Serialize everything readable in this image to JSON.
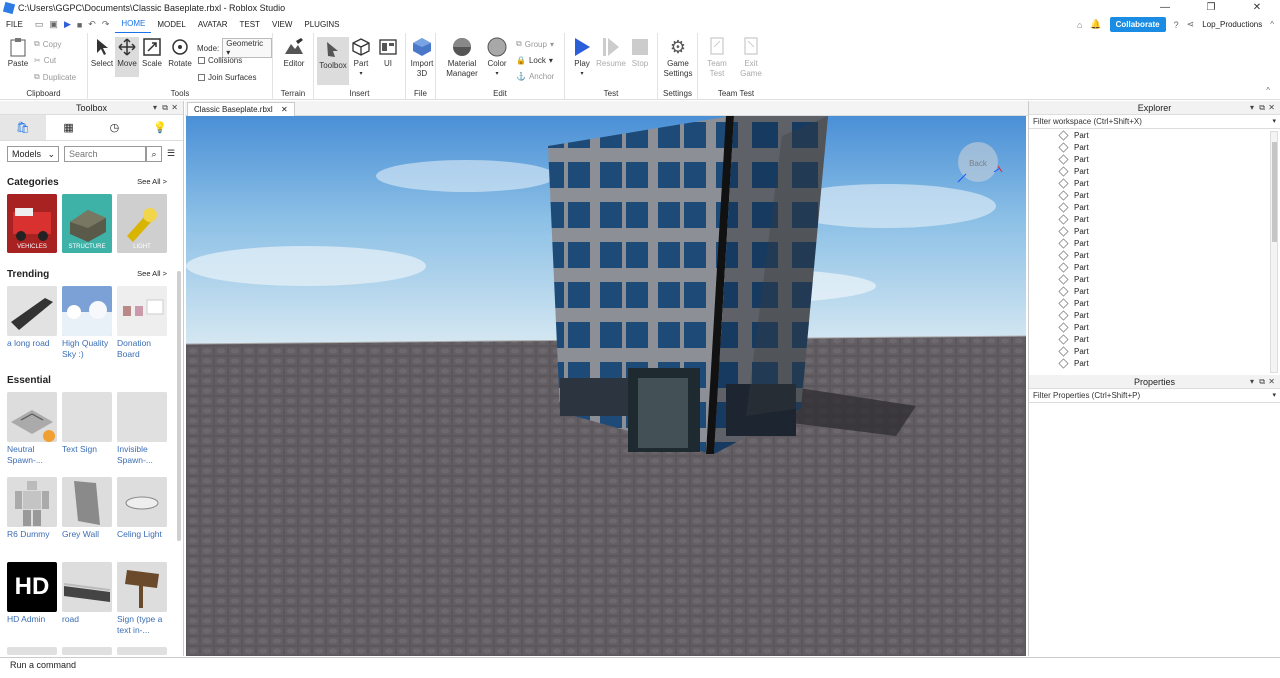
{
  "window": {
    "title": "C:\\Users\\GGPC\\Documents\\Classic Baseplate.rbxl - Roblox Studio"
  },
  "menu": {
    "tabs": [
      "FILE",
      "HOME",
      "MODEL",
      "AVATAR",
      "TEST",
      "VIEW",
      "PLUGINS"
    ],
    "active": "HOME"
  },
  "topright": {
    "collaborate": "Collaborate",
    "user": "Lop_Productions"
  },
  "ribbon": {
    "clipboard": {
      "paste": "Paste",
      "copy": "Copy",
      "cut": "Cut",
      "duplicate": "Duplicate",
      "label": "Clipboard"
    },
    "tools": {
      "select": "Select",
      "move": "Move",
      "scale": "Scale",
      "rotate": "Rotate",
      "mode_label": "Mode:",
      "mode_value": "Geometric",
      "collisions": "Collisions",
      "join_surfaces": "Join Surfaces",
      "label": "Tools"
    },
    "terrain": {
      "editor": "Editor",
      "label": "Terrain"
    },
    "insert": {
      "toolbox": "Toolbox",
      "part": "Part",
      "ui": "UI",
      "label": "Insert"
    },
    "file": {
      "import_line1": "Import",
      "import_line2": "3D",
      "label": "File"
    },
    "edit": {
      "material_line1": "Material",
      "material_line2": "Manager",
      "color": "Color",
      "group": "Group",
      "lock": "Lock",
      "anchor": "Anchor",
      "label": "Edit"
    },
    "test": {
      "play": "Play",
      "resume": "Resume",
      "stop": "Stop",
      "label": "Test"
    },
    "settings": {
      "game_line1": "Game",
      "game_line2": "Settings",
      "label": "Settings"
    },
    "teamtest": {
      "team_line1": "Team",
      "team_line2": "Test",
      "exit_line1": "Exit",
      "exit_line2": "Game",
      "label": "Team Test"
    }
  },
  "toolbox": {
    "title": "Toolbox",
    "category_select": "Models",
    "search_placeholder": "Search",
    "categories_title": "Categories",
    "see_all": "See All >",
    "categories": [
      "VEHICLES",
      "STRUCTURE",
      "LIGHT"
    ],
    "trending_title": "Trending",
    "trending": [
      {
        "name_line1": "a long road",
        "name_line2": ""
      },
      {
        "name_line1": "High Quality",
        "name_line2": "Sky :)"
      },
      {
        "name_line1": "Donation",
        "name_line2": "Board"
      }
    ],
    "essential_title": "Essential",
    "essential": [
      {
        "name_line1": "Neutral",
        "name_line2": "Spawn-..."
      },
      {
        "name_line1": "Text Sign",
        "name_line2": ""
      },
      {
        "name_line1": "Invisible",
        "name_line2": "Spawn-..."
      },
      {
        "name_line1": "R6 Dummy",
        "name_line2": ""
      },
      {
        "name_line1": "Grey Wall",
        "name_line2": ""
      },
      {
        "name_line1": "Celing Light",
        "name_line2": ""
      },
      {
        "name_line1": "HD Admin",
        "name_line2": ""
      },
      {
        "name_line1": "road",
        "name_line2": ""
      },
      {
        "name_line1": "Sign (type a",
        "name_line2": "text in-..."
      }
    ],
    "hd_text": "HD"
  },
  "doc_tab": {
    "name": "Classic Baseplate.rbxl"
  },
  "viewport": {
    "back_label": "Back"
  },
  "explorer": {
    "title": "Explorer",
    "filter": "Filter workspace (Ctrl+Shift+X)",
    "items": [
      "Part",
      "Part",
      "Part",
      "Part",
      "Part",
      "Part",
      "Part",
      "Part",
      "Part",
      "Part",
      "Part",
      "Part",
      "Part",
      "Part",
      "Part",
      "Part",
      "Part",
      "Part",
      "Part",
      "Part"
    ]
  },
  "properties": {
    "title": "Properties",
    "filter": "Filter Properties (Ctrl+Shift+P)"
  },
  "command": {
    "placeholder": "Run a command"
  }
}
